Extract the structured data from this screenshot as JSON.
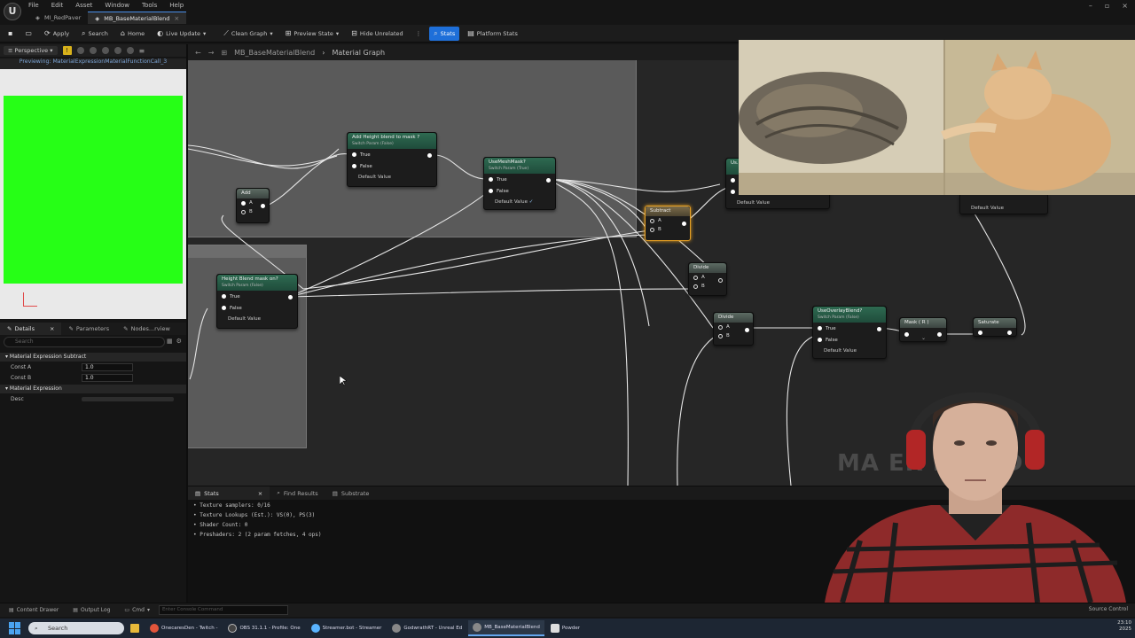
{
  "menu": [
    "File",
    "Edit",
    "Asset",
    "Window",
    "Tools",
    "Help"
  ],
  "doc_tabs": [
    {
      "label": "MI_RedPaver",
      "active": false
    },
    {
      "label": "MB_BaseMaterialBlend",
      "active": true
    }
  ],
  "toolbar": {
    "apply": "Apply",
    "search": "Search",
    "home": "Home",
    "live_update": "Live Update",
    "clean_graph": "Clean Graph",
    "preview_state": "Preview State",
    "hide_unrelated": "Hide Unrelated",
    "stats": "Stats",
    "platform_stats": "Platform Stats"
  },
  "viewport": {
    "mode": "Perspective",
    "previewing": "Previewing: MaterialExpressionMaterialFunctionCall_3",
    "preview_color": "#26ff16"
  },
  "details": {
    "tabs": [
      {
        "label": "Details",
        "active": true
      },
      {
        "label": "Parameters",
        "active": false
      },
      {
        "label": "Nodes...rview",
        "active": false
      }
    ],
    "search_placeholder": "Search",
    "section1": "Material Expression Subtract",
    "const_a_label": "Const A",
    "const_a": "1.0",
    "const_b_label": "Const B",
    "const_b": "1.0",
    "section2": "Material Expression",
    "desc_label": "Desc"
  },
  "graph": {
    "breadcrumb_asset": "MB_BaseMaterialBlend",
    "breadcrumb_graph": "Material Graph",
    "watermark": "MA               ER BLEND",
    "nodes": {
      "add": {
        "title": "Add",
        "a": "A",
        "b": "B"
      },
      "height_blend_mask": {
        "title": "Add Height blend to mask ?",
        "sub": "Switch Param (False)",
        "t": "True",
        "f": "False",
        "def": "Default Value"
      },
      "use_mesh_mask": {
        "title": "UseMeshMask?",
        "sub": "Switch Param (True)",
        "t": "True",
        "f": "False",
        "def": "Default Value"
      },
      "height_blend_on": {
        "title": "Height Blend mask on?",
        "sub": "Switch Param (False)",
        "t": "True",
        "f": "False",
        "def": "Default Value"
      },
      "subtract": {
        "title": "Subtract",
        "a": "A",
        "b": "B"
      },
      "divide1": {
        "title": "Divide",
        "a": "A",
        "b": "B"
      },
      "divide2": {
        "title": "Divide",
        "a": "A",
        "b": "B"
      },
      "use_overlay": {
        "title": "UseOverlayBlend?",
        "sub": "Switch Param (False)",
        "t": "True",
        "f": "False",
        "def": "Default Value"
      },
      "mask_r": {
        "title": "Mask ( R )"
      },
      "saturate": {
        "title": "Saturate"
      },
      "partial1": {
        "title": "Us...",
        "def": "Default Value"
      },
      "partial2": {
        "def": "Default Value"
      }
    }
  },
  "stats": {
    "tabs": [
      {
        "label": "Stats",
        "active": true
      },
      {
        "label": "Find Results",
        "active": false
      },
      {
        "label": "Substrate",
        "active": false
      }
    ],
    "lines": [
      "• Texture samplers: 0/16",
      "• Texture Lookups (Est.): VS(0), PS(3)",
      "• Shader Count: 0",
      "• Preshaders: 2  (2 param fetches, 4 ops)"
    ]
  },
  "statusbar": {
    "content_drawer": "Content Drawer",
    "output_log": "Output Log",
    "cmd": "Cmd",
    "console_placeholder": "Enter Console Command",
    "source_control": "Source Control"
  },
  "taskbar": {
    "search": "Search",
    "apps": [
      {
        "label": "OnecaresDen - Twitch -",
        "color": "#e2553b"
      },
      {
        "label": "OBS 31.1.1 - Profile: One",
        "color": "#444"
      },
      {
        "label": "Streamer.bot - Streamer",
        "color": "#5ab4ff"
      },
      {
        "label": "GodwrathRT - Unreal Ed",
        "color": "#888"
      },
      {
        "label": "MB_BaseMaterialBlend",
        "color": "#888"
      },
      {
        "label": "Powder",
        "color": "#ddd"
      }
    ],
    "time": "23:10",
    "date": "2025"
  }
}
